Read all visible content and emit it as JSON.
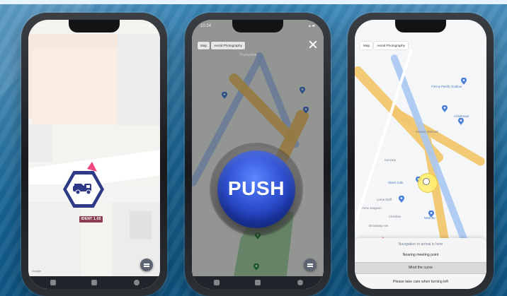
{
  "screens": {
    "first": {
      "vehicle_label": "IDENT 1.05",
      "google": "Google"
    },
    "second": {
      "tabs": [
        "Map",
        "Aerial Photography"
      ],
      "faint_title": "Françoise",
      "push_label": "PUSH"
    },
    "third": {
      "tabs": [
        "Map",
        "Aerial Photography"
      ],
      "poi_labels": [
        "Fitzroy Pacific Outdoor",
        "Al Bahnuar",
        "Eleanor Mahood",
        "Suncorp",
        "Glaze Cafe",
        "Lorna Staff",
        "Medi Bo",
        "Garage Chafestar",
        "Anne Jaugeon",
        "Broadway Ave",
        "Chrishas"
      ],
      "list": [
        "Navigation to arrival is here",
        "Nearing meeting point",
        "Mind the curve",
        "Please take care when turning left"
      ]
    }
  },
  "colors": {
    "accent_pink": "#f0487f",
    "push_blue": "#2f52cf",
    "badge_navy": "#2e3988",
    "map_yellow": "#f1c66e"
  }
}
